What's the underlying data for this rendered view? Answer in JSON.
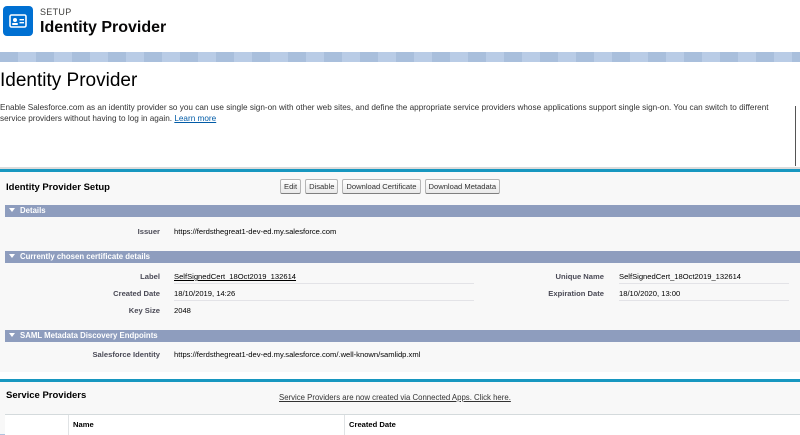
{
  "header": {
    "eyebrow": "SETUP",
    "title": "Identity Provider",
    "icon": "identity-card-icon",
    "accent_color": "#0070d2"
  },
  "page": {
    "title": "Identity Provider",
    "intro_text": "Enable Salesforce.com as an identity provider so you can use single sign-on with other web sites, and define the appropriate service providers whose applications support single sign-on. You can switch to different service providers without having to log in again.",
    "learn_more": "Learn more"
  },
  "setup": {
    "title": "Identity Provider Setup",
    "buttons": {
      "edit": "Edit",
      "disable": "Disable",
      "download_certificate": "Download Certificate",
      "download_metadata": "Download Metadata"
    }
  },
  "details": {
    "section_title": "Details",
    "issuer_label": "Issuer",
    "issuer_value": "https://ferdsthegreat1-dev-ed.my.salesforce.com"
  },
  "certificate": {
    "section_title": "Currently chosen certificate details",
    "label_label": "Label",
    "label_value": "SelfSignedCert_18Oct2019_132614",
    "unique_name_label": "Unique Name",
    "unique_name_value": "SelfSignedCert_18Oct2019_132614",
    "created_date_label": "Created Date",
    "created_date_value": "18/10/2019, 14:26",
    "expiration_date_label": "Expiration Date",
    "expiration_date_value": "18/10/2020, 13:00",
    "key_size_label": "Key Size",
    "key_size_value": "2048"
  },
  "saml": {
    "section_title": "SAML Metadata Discovery Endpoints",
    "sf_identity_label": "Salesforce Identity",
    "sf_identity_value": "https://ferdsthegreat1-dev-ed.my.salesforce.com/.well-known/samlidp.xml"
  },
  "service_providers": {
    "title": "Service Providers",
    "note_link": "Service Providers are now created via Connected Apps. Click here.",
    "columns": [
      "Name",
      "Created Date"
    ]
  }
}
